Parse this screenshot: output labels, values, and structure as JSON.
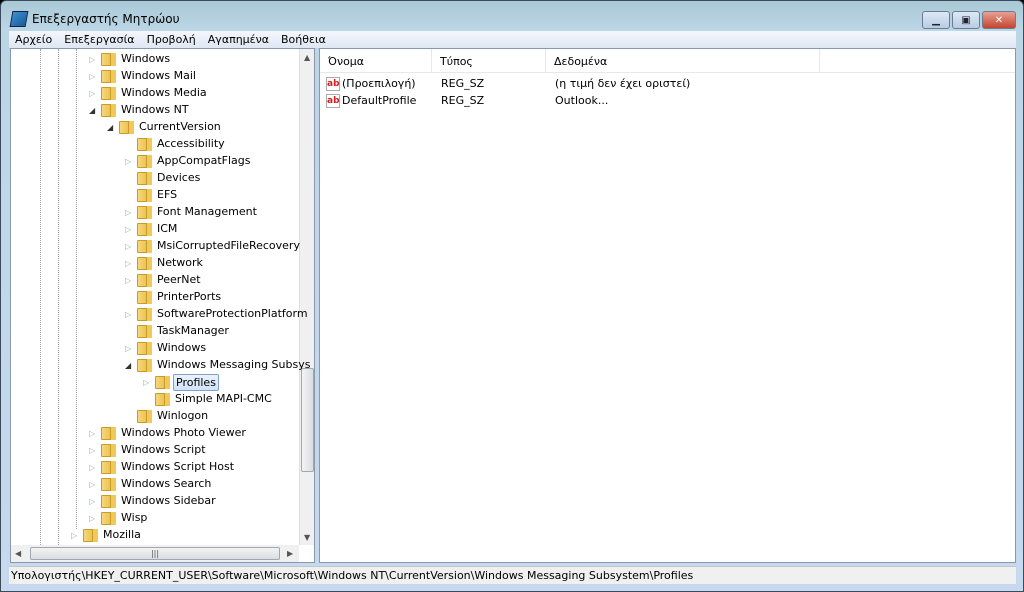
{
  "window": {
    "title": "Επεξεργαστής Μητρώου",
    "icon": "registry-editor-icon",
    "controls": [
      "minimize",
      "maximize",
      "close"
    ]
  },
  "menu": [
    "Αρχείο",
    "Επεξεργασία",
    "Προβολή",
    "Αγαπημένα",
    "Βοήθεια"
  ],
  "tree": [
    {
      "label": "Windows",
      "level": 2,
      "state": "collapsed"
    },
    {
      "label": "Windows Mail",
      "level": 2,
      "state": "collapsed"
    },
    {
      "label": "Windows Media",
      "level": 2,
      "state": "collapsed"
    },
    {
      "label": "Windows NT",
      "level": 2,
      "state": "expanded"
    },
    {
      "label": "CurrentVersion",
      "level": 3,
      "state": "expanded"
    },
    {
      "label": "Accessibility",
      "level": 4,
      "state": "none"
    },
    {
      "label": "AppCompatFlags",
      "level": 4,
      "state": "collapsed"
    },
    {
      "label": "Devices",
      "level": 4,
      "state": "none"
    },
    {
      "label": "EFS",
      "level": 4,
      "state": "none"
    },
    {
      "label": "Font Management",
      "level": 4,
      "state": "collapsed"
    },
    {
      "label": "ICM",
      "level": 4,
      "state": "collapsed"
    },
    {
      "label": "MsiCorruptedFileRecovery",
      "level": 4,
      "state": "collapsed"
    },
    {
      "label": "Network",
      "level": 4,
      "state": "collapsed"
    },
    {
      "label": "PeerNet",
      "level": 4,
      "state": "collapsed"
    },
    {
      "label": "PrinterPorts",
      "level": 4,
      "state": "none"
    },
    {
      "label": "SoftwareProtectionPlatform",
      "level": 4,
      "state": "collapsed"
    },
    {
      "label": "TaskManager",
      "level": 4,
      "state": "none"
    },
    {
      "label": "Windows",
      "level": 4,
      "state": "collapsed"
    },
    {
      "label": "Windows Messaging Subsys",
      "level": 4,
      "state": "expanded"
    },
    {
      "label": "Profiles",
      "level": 5,
      "state": "collapsed",
      "selected": true
    },
    {
      "label": "Simple MAPI-CMC",
      "level": 5,
      "state": "none"
    },
    {
      "label": "Winlogon",
      "level": 4,
      "state": "none"
    },
    {
      "label": "Windows Photo Viewer",
      "level": 2,
      "state": "collapsed"
    },
    {
      "label": "Windows Script",
      "level": 2,
      "state": "collapsed"
    },
    {
      "label": "Windows Script Host",
      "level": 2,
      "state": "collapsed"
    },
    {
      "label": "Windows Search",
      "level": 2,
      "state": "collapsed"
    },
    {
      "label": "Windows Sidebar",
      "level": 2,
      "state": "collapsed"
    },
    {
      "label": "Wisp",
      "level": 2,
      "state": "collapsed"
    },
    {
      "label": "Mozilla",
      "level": 1,
      "state": "collapsed"
    }
  ],
  "list": {
    "columns": [
      "Όνομα",
      "Τύπος",
      "Δεδομένα"
    ],
    "rows": [
      {
        "name": "(Προεπιλογή)",
        "type": "REG_SZ",
        "data": "(η τιμή δεν έχει οριστεί)",
        "icon": "string-value-icon"
      },
      {
        "name": "DefaultProfile",
        "type": "REG_SZ",
        "data": "Outlook...",
        "icon": "string-value-icon"
      }
    ]
  },
  "status": "Υπολογιστής\\HKEY_CURRENT_USER\\Software\\Microsoft\\Windows NT\\CurrentVersion\\Windows Messaging Subsystem\\Profiles",
  "colors": {
    "selection": "#d2e3f8",
    "title_bar": "#bcd6e6",
    "close_button": "#c5442f"
  }
}
